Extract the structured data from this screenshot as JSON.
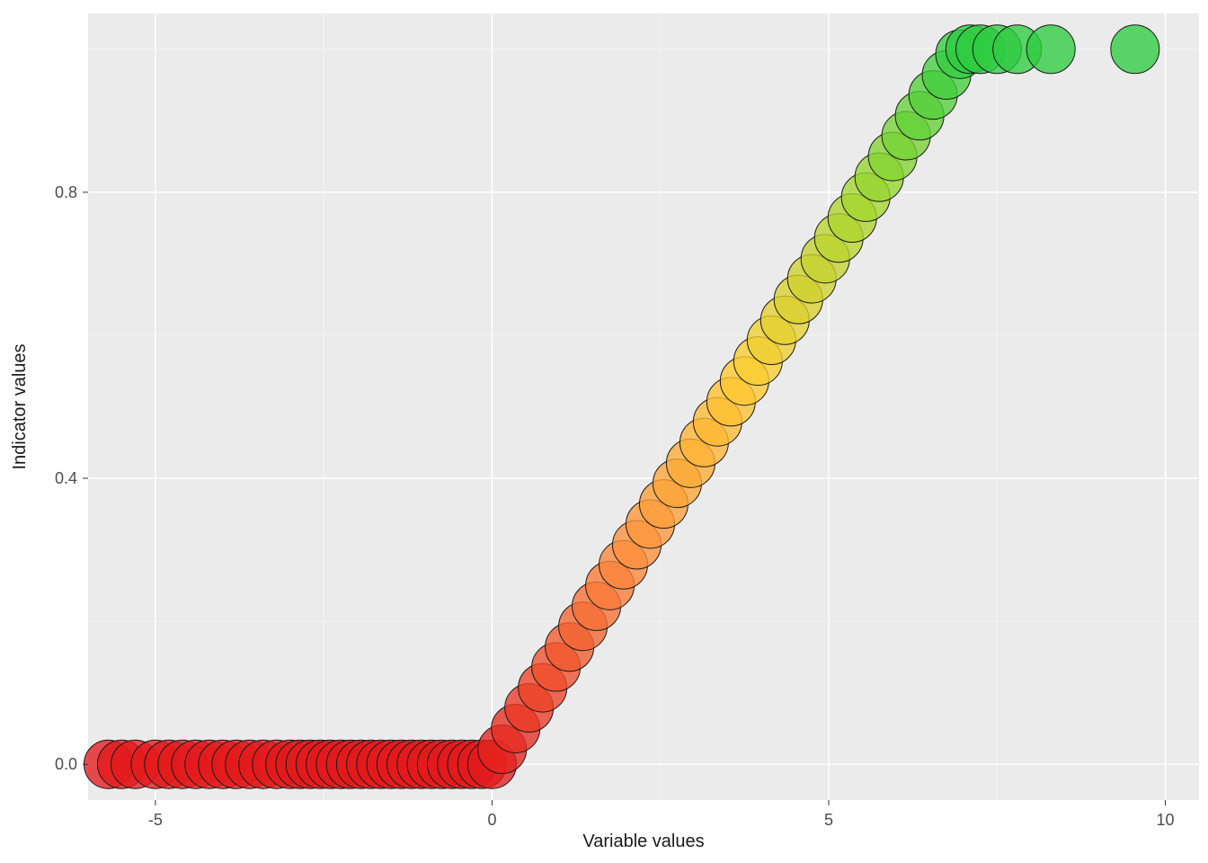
{
  "chart_data": {
    "type": "scatter",
    "title": "",
    "xlabel": "Variable values",
    "ylabel": "Indicator values",
    "xlim": [
      -6,
      10.5
    ],
    "ylim": [
      -0.05,
      1.05
    ],
    "x_ticks": [
      -5,
      0,
      5,
      10
    ],
    "y_ticks": [
      0.0,
      0.4,
      0.8
    ],
    "x_minor": [
      -2.5,
      2.5,
      7.5
    ],
    "y_minor": [
      0.2,
      0.6,
      1.0
    ],
    "color_low": "#e41a1c",
    "color_mid": "#fdae2f",
    "color_high": "#2ecc40",
    "x": [
      -5.7,
      -5.5,
      -5.3,
      -5.0,
      -4.8,
      -4.6,
      -4.4,
      -4.2,
      -4.0,
      -3.8,
      -3.6,
      -3.4,
      -3.2,
      -3.0,
      -2.85,
      -2.7,
      -2.55,
      -2.4,
      -2.25,
      -2.1,
      -1.95,
      -1.8,
      -1.65,
      -1.5,
      -1.35,
      -1.2,
      -1.05,
      -0.9,
      -0.75,
      -0.6,
      -0.45,
      -0.3,
      -0.15,
      0.0,
      0.15,
      0.35,
      0.55,
      0.75,
      0.95,
      1.15,
      1.35,
      1.55,
      1.75,
      1.95,
      2.15,
      2.35,
      2.55,
      2.75,
      2.95,
      3.15,
      3.35,
      3.55,
      3.75,
      3.95,
      4.15,
      4.35,
      4.55,
      4.75,
      4.95,
      5.15,
      5.35,
      5.55,
      5.75,
      5.95,
      6.15,
      6.35,
      6.55,
      6.75,
      6.95,
      7.1,
      7.25,
      7.5,
      7.8,
      8.3,
      9.55
    ],
    "y": [
      0.0,
      0.0,
      0.0,
      0.0,
      0.0,
      0.0,
      0.0,
      0.0,
      0.0,
      0.0,
      0.0,
      0.0,
      0.0,
      0.0,
      0.0,
      0.0,
      0.0,
      0.0,
      0.0,
      0.0,
      0.0,
      0.0,
      0.0,
      0.0,
      0.0,
      0.0,
      0.0,
      0.0,
      0.0,
      0.0,
      0.0,
      0.0,
      0.0,
      0.0,
      0.021,
      0.05,
      0.079,
      0.107,
      0.136,
      0.164,
      0.193,
      0.221,
      0.25,
      0.279,
      0.307,
      0.336,
      0.364,
      0.393,
      0.421,
      0.45,
      0.479,
      0.507,
      0.536,
      0.564,
      0.593,
      0.621,
      0.65,
      0.679,
      0.707,
      0.736,
      0.764,
      0.793,
      0.821,
      0.85,
      0.879,
      0.907,
      0.936,
      0.964,
      0.993,
      1.0,
      1.0,
      1.0,
      1.0,
      1.0,
      1.0
    ]
  }
}
